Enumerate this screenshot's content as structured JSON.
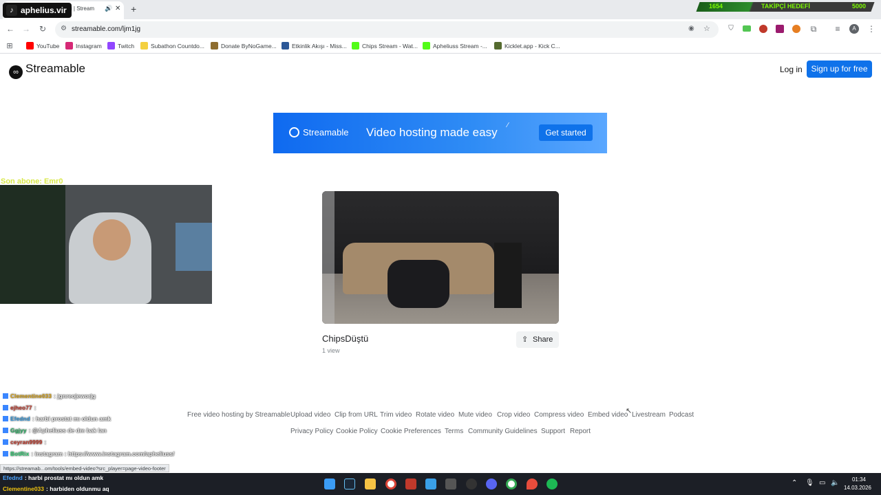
{
  "browser": {
    "tab_title": "ştü | Stream",
    "url": "streamable.com/ljm1jg",
    "bookmarks": [
      {
        "label": "YouTube",
        "color": "#ff0000"
      },
      {
        "label": "Instagram",
        "color": "#d62976"
      },
      {
        "label": "Twitch",
        "color": "#9146ff"
      },
      {
        "label": "Subathon Countdo...",
        "color": "#f4d03f"
      },
      {
        "label": "Donate ByNoGame...",
        "color": "#8e6d2f"
      },
      {
        "label": "Etkinlik Akışı - Miss...",
        "color": "#2b5797"
      },
      {
        "label": "Chips Stream - Wat...",
        "color": "#53fc18"
      },
      {
        "label": "Apheliuss Stream -...",
        "color": "#53fc18"
      },
      {
        "label": "Kicklet.app - Kick C...",
        "color": "#556b2f"
      }
    ],
    "profile_initial": "A"
  },
  "stream_overlay": {
    "channel": "aphelius.vir",
    "goal_current": "1654",
    "goal_label": "TAKİPÇİ HEDEFİ",
    "goal_target": "5000",
    "last_sub": "Son abone: Emr0",
    "status_url": "https://streamab...om/tools/embed-video?src_player=page-video-footer",
    "chat": [
      {
        "user": "Clementine033",
        "msg": ": jgnreojeworjg",
        "color": "#d4a017"
      },
      {
        "user": "ejheo77",
        "msg": ":",
        "color": "#c0392b"
      },
      {
        "user": "Efednd",
        "msg": ": harbi prostat mı oldun amk",
        "color": "#3498db"
      },
      {
        "user": "Ggjyy",
        "msg": ": @Apheliuss de dm bak lan",
        "color": "#27ae60"
      },
      {
        "user": "ceyran9999",
        "msg": ":",
        "color": "#c0392b"
      },
      {
        "user": "BotRix",
        "msg": ": instagram : https://www.instagram.com/apheliuss/",
        "color": "#2ecc71"
      },
      {
        "user": "Efednd",
        "msg": ": harbi prostat mı oldun amk",
        "color": "#4aa3ff"
      },
      {
        "user": "Clementine033",
        "msg": ": harbiden oldunmu aq",
        "color": "#f1c40f"
      }
    ]
  },
  "page": {
    "logo": "Streamable",
    "login": "Log in",
    "signup": "Sign up for free",
    "banner": {
      "logo": "Streamable",
      "headline": "Video hosting made easy",
      "cta": "Get started"
    },
    "video": {
      "title": "ChipsDüştü",
      "views": "1 view",
      "share": "Share"
    },
    "footer_links_row1": [
      "Free video hosting by Streamable",
      "Upload video",
      "Clip from URL",
      "Trim video",
      "Rotate video",
      "Mute video",
      "Crop video",
      "Compress video",
      "Embed video",
      "Livestream",
      "Podcast"
    ],
    "footer_links_row2": [
      "Privacy Policy",
      "Cookie Policy",
      "Cookie Preferences",
      "Terms",
      "Community Guidelines",
      "Support",
      "Report"
    ]
  },
  "taskbar": {
    "time": "01:34",
    "date": "14.03.2026"
  }
}
